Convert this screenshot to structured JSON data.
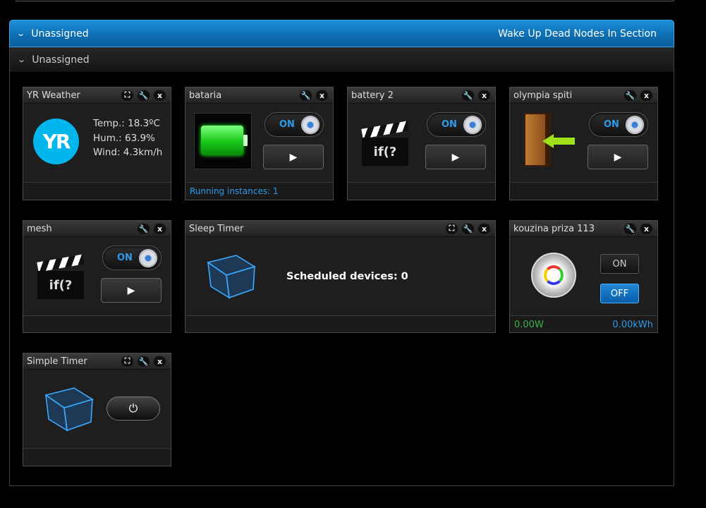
{
  "section": {
    "title": "Unassigned",
    "action": "Wake Up Dead Nodes In Section",
    "subtitle": "Unassigned"
  },
  "widgets": {
    "yr": {
      "title": "YR Weather",
      "logo": "YR",
      "temp": "Temp.: 18.3ºC",
      "hum": "Hum.: 63.9%",
      "wind": "Wind: 4.3km/h"
    },
    "bataria": {
      "title": "bataria",
      "toggle": "ON",
      "footer": "Running instances: 1"
    },
    "battery2": {
      "title": "battery 2",
      "toggle": "ON",
      "clap_text": "if(?"
    },
    "olympia": {
      "title": "olympia spiti",
      "toggle": "ON"
    },
    "mesh": {
      "title": "mesh",
      "toggle": "ON",
      "clap_text": "if(?"
    },
    "sleep": {
      "title": "Sleep Timer",
      "text": "Scheduled devices: 0"
    },
    "kouzina": {
      "title": "kouzina priza 113",
      "on": "ON",
      "off": "OFF",
      "power": "0.00W",
      "energy": "0.00kWh"
    },
    "simple": {
      "title": "Simple Timer"
    }
  },
  "icons": {
    "expand": "expand-icon",
    "wrench": "wrench-icon",
    "close": "close-icon",
    "play": "play-icon",
    "power": "power-icon"
  },
  "colors": {
    "accent": "#2e9bea",
    "header_blue": "#0d6fb3",
    "power_green": "#3cb34a"
  }
}
